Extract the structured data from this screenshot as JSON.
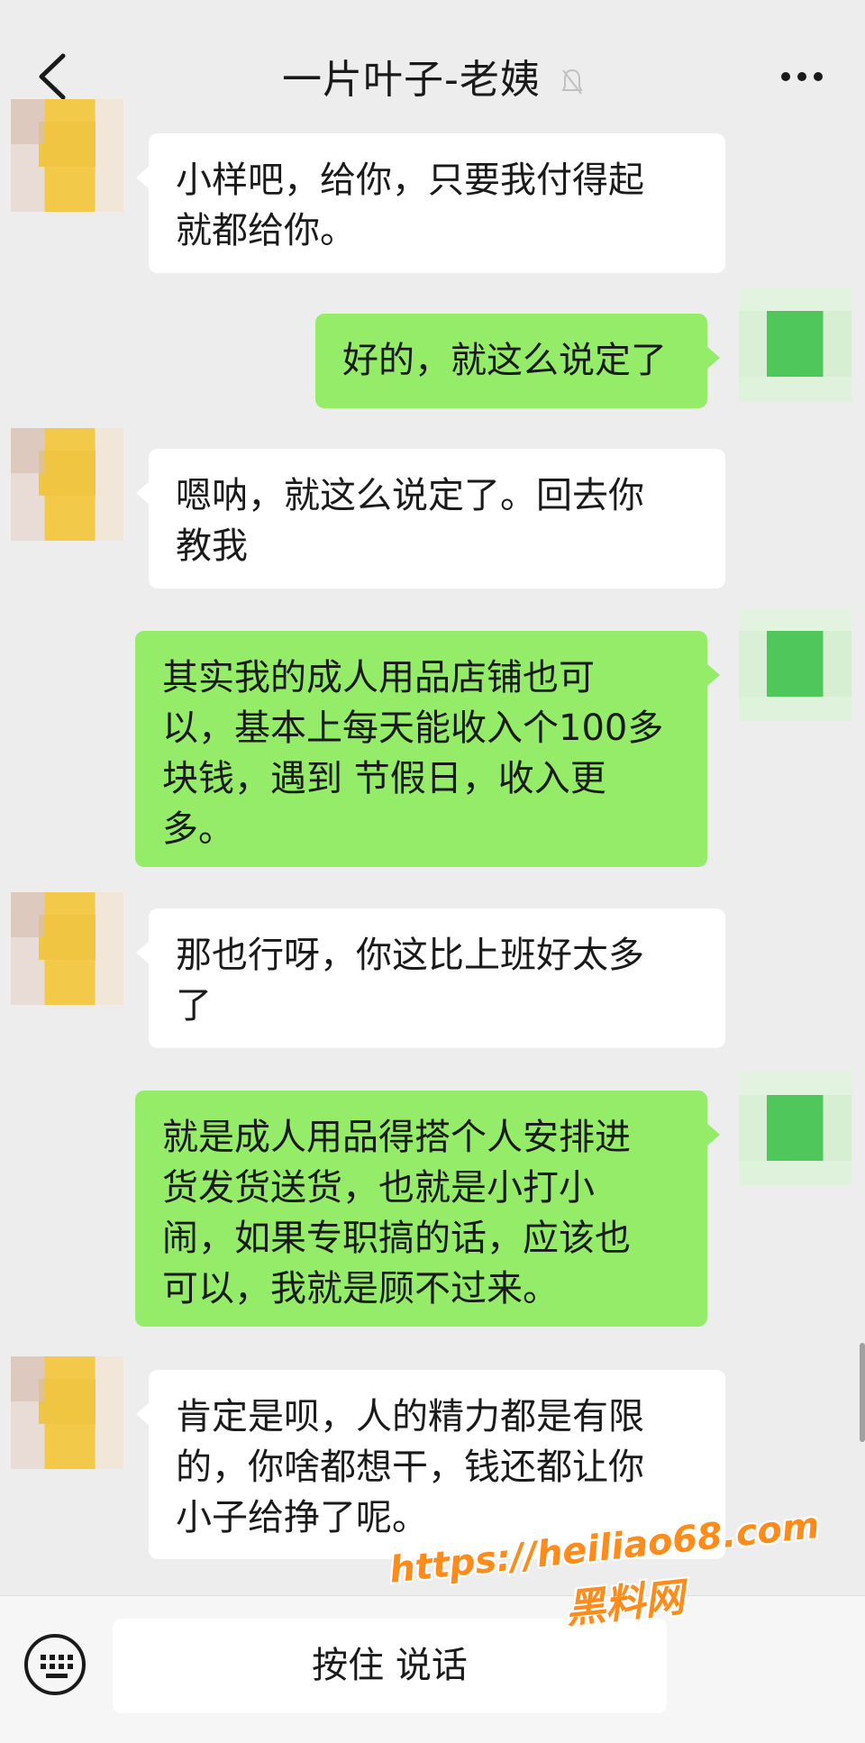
{
  "header": {
    "title": "一片叶子-老姨",
    "back_icon": "chevron-left-icon",
    "mute_icon": "mute-icon",
    "more_icon": "more-icon"
  },
  "messages": [
    {
      "side": "in",
      "text": "小样吧，给你，只要我付得起\n就都给你。"
    },
    {
      "side": "out",
      "text": "好的，就这么说定了"
    },
    {
      "side": "in",
      "text": "嗯呐，就这么说定了。回去你\n教我"
    },
    {
      "side": "out",
      "text": "其实我的成人用品店铺也可\n以，基本上每天能收入个100多\n块钱，遇到 节假日，收入更\n多。"
    },
    {
      "side": "in",
      "text": "那也行呀，你这比上班好太多\n了"
    },
    {
      "side": "out",
      "text": "就是成人用品得搭个人安排进\n货发货送货，也就是小打小\n闹，如果专职搞的话，应该也\n可以，我就是顾不过来。"
    },
    {
      "side": "in",
      "text": "肯定是呗，人的精力都是有限\n的，你啥都想干，钱还都让你\n小子给挣了呢。"
    }
  ],
  "footer": {
    "voice_button_label": "按住 说话",
    "keyboard_icon": "keyboard-icon"
  },
  "watermark": {
    "url": "https://heiliao68.com",
    "site_name": "黑料网"
  },
  "colors": {
    "background": "#ededed",
    "incoming_bubble": "#ffffff",
    "outgoing_bubble": "#95ec69",
    "watermark": "#ff8c1a"
  }
}
